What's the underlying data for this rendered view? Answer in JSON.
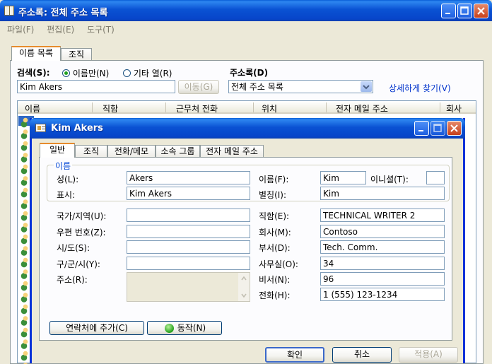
{
  "main_window": {
    "title": "주소록: 전체 주소 목록",
    "menu": [
      "파일(F)",
      "편집(E)",
      "도구(T)"
    ],
    "tabs": [
      "이름 목록",
      "조직"
    ],
    "search_label": "검색(S):",
    "radio_name_only": "이름만(N)",
    "radio_other_column": "기타 열(R)",
    "search_value": "Kim Akers",
    "go_button": "이동(G)",
    "address_book_label": "주소록(D)",
    "address_book_value": "전체 주소 목록",
    "advanced_find_link": "상세하게 찾기(V)",
    "columns": [
      "이름",
      "직함",
      "근무처 전화",
      "위치",
      "전자 메일 주소",
      "회사"
    ]
  },
  "dialog": {
    "title": "Kim Akers",
    "tabs": [
      "일반",
      "조직",
      "전화/메모",
      "소속 그룹",
      "전자 메일 주소"
    ],
    "group_label": "이름",
    "last_name_label": "성(L):",
    "last_name_value": "Akers",
    "first_name_label": "이름(F):",
    "first_name_value": "Kim",
    "initials_label": "이니셜(T):",
    "initials_value": "",
    "display_label": "표시:",
    "display_value": "Kim Akers",
    "alias_label": "별칭(I):",
    "alias_value": "Kim",
    "country_label": "국가/지역(U):",
    "country_value": "",
    "zip_label": "우편 번호(Z):",
    "zip_value": "",
    "state_label": "시/도(S):",
    "state_value": "",
    "city_label": "구/군/시(Y):",
    "city_value": "",
    "address_label": "주소(R):",
    "address_value": "",
    "title_label": "직함(E):",
    "title_value": "TECHNICAL WRITER 2",
    "company_label": "회사(M):",
    "company_value": "Contoso",
    "department_label": "부서(D):",
    "department_value": "Tech. Comm.",
    "office_label": "사무실(O):",
    "office_value": "34",
    "assistant_label": "비서(N):",
    "assistant_value": "96",
    "phone_label": "전화(H):",
    "phone_value": "1 (555) 123-1234",
    "add_contact_button": "연락처에 추가(C)",
    "action_button": "동작(N)",
    "ok_button": "확인",
    "cancel_button": "취소",
    "apply_button": "적용(A)"
  }
}
